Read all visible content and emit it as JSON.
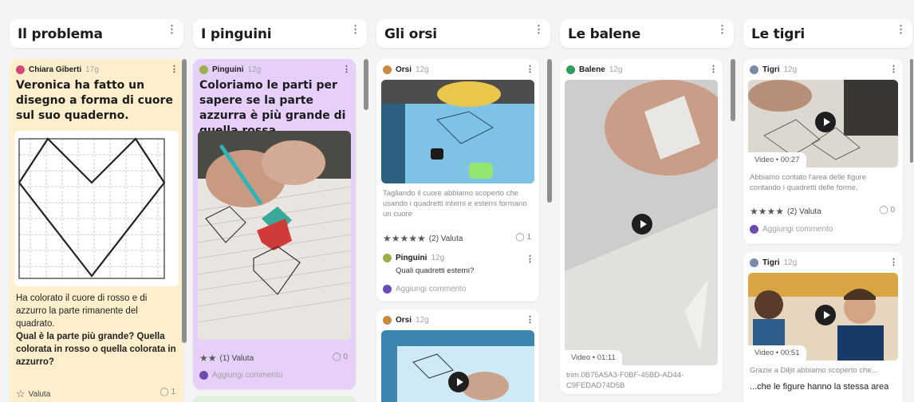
{
  "columns": [
    {
      "title": "Il problema"
    },
    {
      "title": "I pinguini"
    },
    {
      "title": "Gli orsi"
    },
    {
      "title": "Le balene"
    },
    {
      "title": "Le tigri"
    }
  ],
  "cards": {
    "problema": {
      "author": "Chiara Giberti",
      "time": "17g",
      "title": "Veronica ha fatto un disegno a forma di cuore sul suo quaderno.",
      "body_plain": "Ha colorato il cuore di rosso e di azzurro la parte rimanente del quadrato.",
      "body_bold": "Qual è la parte più grande? Quella colorata in rosso o quella colorata in azzurro?",
      "rate_label": "Valuta",
      "comments": "1"
    },
    "pinguini": {
      "author": "Pinguini",
      "time": "12g",
      "title": "Coloriamo le parti per sapere se la parte azzurra è più grande di quella rossa",
      "rating": "(1) Valuta",
      "comments": "0",
      "add_comment": "Aggiungi commento"
    },
    "orsi1": {
      "author": "Orsi",
      "time": "12g",
      "caption": "Tagliando il cuore abbiamo scoperto che usando i quadretti interni e esterni formano un cuore",
      "rating": "(2) Valuta",
      "comments": "1",
      "reply_author": "Pinguini",
      "reply_time": "12g",
      "reply_text": "Quali quadretti esterni?",
      "add_comment": "Aggiungi commento"
    },
    "orsi2": {
      "author": "Orsi",
      "time": "12g"
    },
    "balene": {
      "author": "Balene",
      "time": "12g",
      "video": "Video • 01:11",
      "filename": "trim.0B75A5A3-F0BF-45BD-AD44-C9FEDAD74D5B"
    },
    "tigri1": {
      "author": "Tigri",
      "time": "12g",
      "video": "Video • 00:27",
      "caption": "Abbiamo contato l'area delle figure contando i quadretti delle forme,",
      "rating": "(2) Valuta",
      "comments": "0",
      "add_comment": "Aggiungi commento"
    },
    "tigri2": {
      "author": "Tigri",
      "time": "12g",
      "video": "Video • 00:51",
      "caption": "Grazie a Diljit abbiamo scoperto che...",
      "body": "...che le figure hanno la stessa area"
    }
  },
  "colors": {
    "problema_bg": "#fdefcb",
    "pinguini_bg": "#e6cff9",
    "accent_red": "#d63a3a",
    "accent_teal": "#3bb0a0"
  },
  "icons": [
    "kebab-icon",
    "star-icon",
    "comment-icon",
    "play-icon",
    "avatar-icon"
  ]
}
